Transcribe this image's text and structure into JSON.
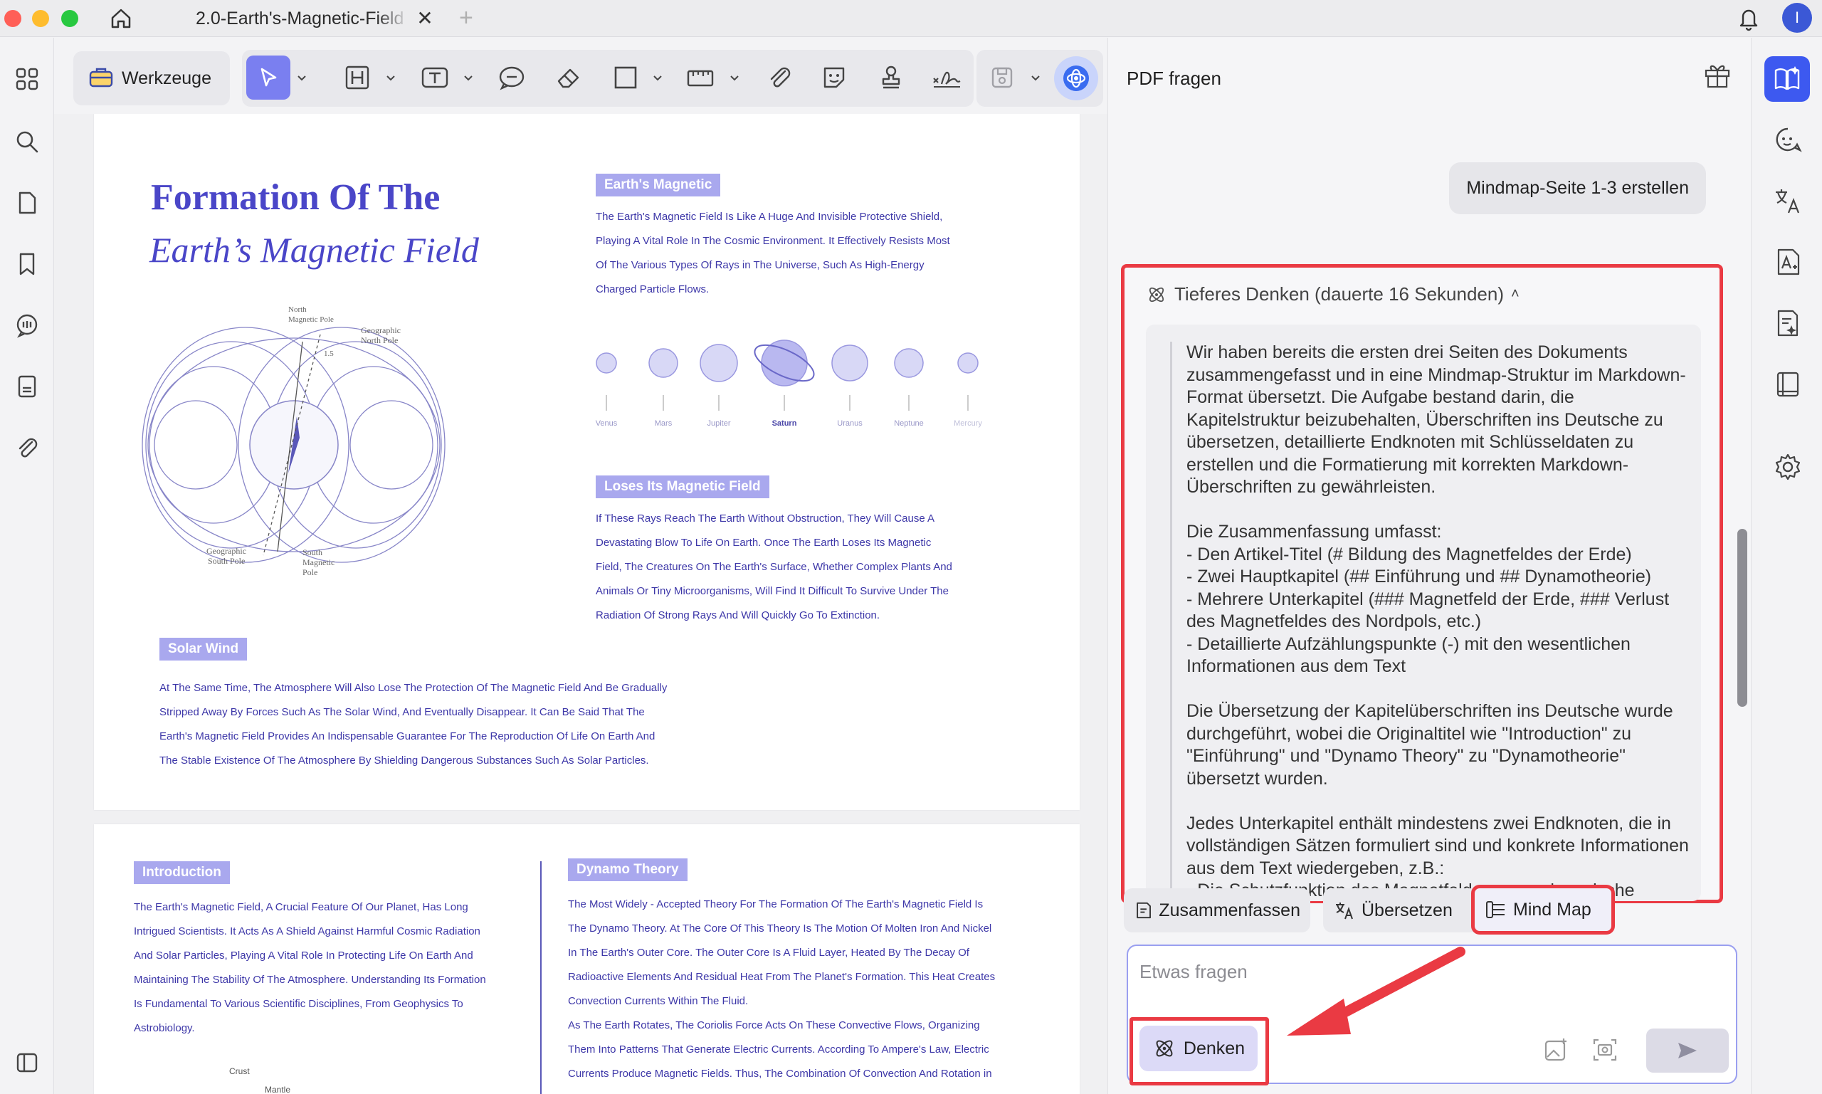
{
  "tab": {
    "title": "2.0-Earth's-Magnetic-Field",
    "close_glyph": "✕",
    "add_glyph": "+"
  },
  "user": {
    "avatar_letter": "I"
  },
  "toolbar": {
    "werkzeuge_label": "Werkzeuge"
  },
  "document": {
    "page1": {
      "title_line1": "Formation Of The",
      "title_line2": "Earth’s Magnetic Field",
      "earths_magnetic_head": "Earth's Magnetic",
      "earths_magnetic_text": "The Earth's Magnetic Field Is Like A Huge And Invisible Protective Shield,\nPlaying A Vital Role In The Cosmic Environment. It Effectively Resists Most\nOf The Various Types Of Rays in The Universe, Such As High-Energy\nCharged Particle Flows.",
      "planets": [
        "Venus",
        "Mars",
        "Jupiter",
        "Saturn",
        "Uranus",
        "Neptune",
        "Mercury"
      ],
      "loses_head": "Loses Its Magnetic Field",
      "loses_text": "If These Rays Reach The Earth Without Obstruction, They Will Cause A\nDevastating Blow To Life On Earth. Once The Earth Loses Its Magnetic\nField, The Creatures On The Earth's Surface, Whether Complex Plants And\nAnimals Or Tiny Microorganisms, Will Find It Difficult To Survive Under The\nRadiation Of Strong Rays And Will Quickly Go To Extinction.",
      "solar_head": "Solar Wind",
      "solar_text": "At The Same Time, The Atmosphere Will Also Lose The Protection Of The Magnetic Field And Be Gradually\nStripped Away By Forces Such As The Solar Wind, And Eventually Disappear. It Can Be Said That The\nEarth's Magnetic Field Provides An Indispensable Guarantee For The Reproduction Of Life On Earth And\nThe Stable Existence Of The Atmosphere By Shielding Dangerous Substances Such As Solar Particles.",
      "diagram_labels": {
        "north_magnetic": "North\nMagnetic Pole",
        "geo_north": "Geographic\nNorth Pole",
        "angle": "1.5",
        "geo_south": "Geographic\nSouth Pole",
        "south_magnetic": "South\nMagnetic\nPole"
      }
    },
    "page2": {
      "intro_head": "Introduction",
      "intro_text": "The Earth's Magnetic Field, A Crucial Feature Of Our Planet, Has Long\nIntrigued Scientists. It Acts As A Shield Against Harmful Cosmic Radiation\nAnd Solar Particles, Playing A Vital Role In Protecting Life On Earth And\nMaintaining The Stability Of The Atmosphere. Understanding Its Formation\nIs Fundamental To Various Scientific Disciplines, From Geophysics To\nAstrobiology.",
      "dynamo_head": "Dynamo Theory",
      "dynamo_text": "The Most Widely - Accepted Theory For The Formation Of The Earth's Magnetic Field Is\nThe Dynamo Theory. At The Core Of This Theory Is The Motion Of Molten Iron And Nickel\nIn The Earth's Outer Core. The Outer Core Is A Fluid Layer, Heated By The Decay Of\nRadioactive Elements And Residual Heat From The Planet's Formation. This Heat Creates\nConvection Currents Within The Fluid.\nAs The Earth Rotates, The Coriolis Force Acts On These Convective Flows, Organizing\nThem Into Patterns That Generate Electric Currents. According To Ampere's Law, Electric\nCurrents Produce Magnetic Fields. Thus, The Combination Of Convection And Rotation in",
      "crust_label": "Crust",
      "mantle_label": "Mantle"
    }
  },
  "panel": {
    "title": "PDF fragen",
    "user_message": "Mindmap-Seite 1-3 erstellen",
    "thinking_header": "Tieferes Denken (dauerte 16 Sekunden)",
    "thinking_caret": "˄",
    "thinking_text": "Wir haben bereits die ersten drei Seiten des Dokuments zusammengefasst und in eine Mindmap-Struktur im Markdown-Format übersetzt. Die Aufgabe bestand darin, die Kapitelstruktur beizubehalten, Überschriften ins Deutsche zu übersetzen, detaillierte Endknoten mit Schlüsseldaten zu erstellen und die Formatierung mit korrekten Markdown-Überschriften zu gewährleisten.\n\nDie Zusammenfassung umfasst:\n- Den Artikel-Titel (# Bildung des Magnetfeldes der Erde)\n- Zwei Hauptkapitel (## Einführung und ## Dynamotheorie)\n- Mehrere Unterkapitel (### Magnetfeld der Erde, ### Verlust des Magnetfeldes des Nordpols, etc.)\n- Detaillierte Aufzählungspunkte (-) mit den wesentlichen Informationen aus dem Text\n\nDie Übersetzung der Kapitelüberschriften ins Deutsche wurde durchgeführt, wobei die Originaltitel wie \"Introduction\" zu \"Einführung\" und \"Dynamo Theory\" zu \"Dynamotheorie\" übersetzt wurden.\n\nJedes Unterkapitel enthält mindestens zwei Endknoten, die in vollständigen Sätzen formuliert sind und konkrete Informationen aus dem Text wiedergeben, z.B.:\n- Die Schutzfunktion des Magnetfeldes gegen kosmische Strahlung",
    "chips": {
      "summarize": "Zusammenfassen",
      "translate": "Übersetzen",
      "mindmap": "Mind Map"
    },
    "input": {
      "placeholder": "Etwas fragen",
      "value": ""
    },
    "denken_label": "Denken"
  },
  "colors": {
    "accent": "#3d59f0",
    "highlight_red": "#ea3a43",
    "doc_text": "#3d37a8",
    "doc_title": "#4a46c8",
    "section_head_bg": "#a9a8ee"
  }
}
